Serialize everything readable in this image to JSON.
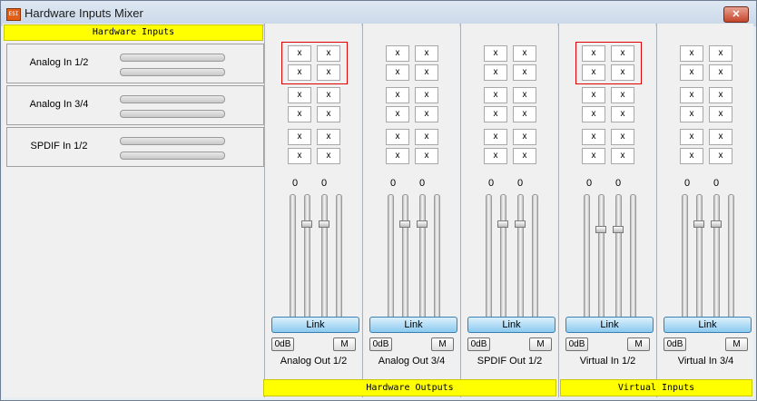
{
  "window": {
    "title": "Hardware Inputs Mixer",
    "icon_text": "ESI",
    "close_glyph": "✕"
  },
  "left_panel": {
    "header": "Hardware Inputs",
    "inputs": [
      {
        "label": "Analog In  1/2"
      },
      {
        "label": "Analog In  3/4"
      },
      {
        "label": "SPDIF In 1/2"
      }
    ]
  },
  "footer": {
    "hardware_outputs": "Hardware Outputs",
    "virtual_inputs": "Virtual Inputs"
  },
  "strips": [
    {
      "name": "Analog Out 1/2",
      "left_value": "0",
      "right_value": "0",
      "link": "Link",
      "zero_db": "0dB",
      "mute": "M",
      "cells": [
        "x",
        "x",
        "x",
        "x",
        "x",
        "x",
        "x",
        "x",
        "x",
        "x",
        "x",
        "x"
      ],
      "left_level": 0.82,
      "right_level": 0.82
    },
    {
      "name": "Analog Out 3/4",
      "left_value": "0",
      "right_value": "0",
      "link": "Link",
      "zero_db": "0dB",
      "mute": "M",
      "cells": [
        "x",
        "x",
        "x",
        "x",
        "x",
        "x",
        "x",
        "x",
        "x",
        "x",
        "x",
        "x"
      ],
      "left_level": 0.82,
      "right_level": 0.82
    },
    {
      "name": "SPDIF Out 1/2",
      "left_value": "0",
      "right_value": "0",
      "link": "Link",
      "zero_db": "0dB",
      "mute": "M",
      "cells": [
        "x",
        "x",
        "x",
        "x",
        "x",
        "x",
        "x",
        "x",
        "x",
        "x",
        "x",
        "x"
      ],
      "left_level": 0.82,
      "right_level": 0.82
    },
    {
      "name": "Virtual In 1/2",
      "left_value": "0",
      "right_value": "0",
      "link": "Link",
      "zero_db": "0dB",
      "mute": "M",
      "cells": [
        "x",
        "x",
        "x",
        "x",
        "x",
        "x",
        "x",
        "x",
        "x",
        "x",
        "x",
        "x"
      ],
      "left_level": 0.78,
      "right_level": 0.78
    },
    {
      "name": "Virtual In 3/4",
      "left_value": "0",
      "right_value": "0",
      "link": "Link",
      "zero_db": "0dB",
      "mute": "M",
      "cells": [
        "x",
        "x",
        "x",
        "x",
        "x",
        "x",
        "x",
        "x",
        "x",
        "x",
        "x",
        "x"
      ],
      "left_level": 0.82,
      "right_level": 0.82
    }
  ],
  "highlighted_strips": [
    0,
    3
  ],
  "colors": {
    "header_yellow": "#ffff00",
    "highlight_red": "#e00000",
    "link_blue": "#8ccaf0"
  }
}
